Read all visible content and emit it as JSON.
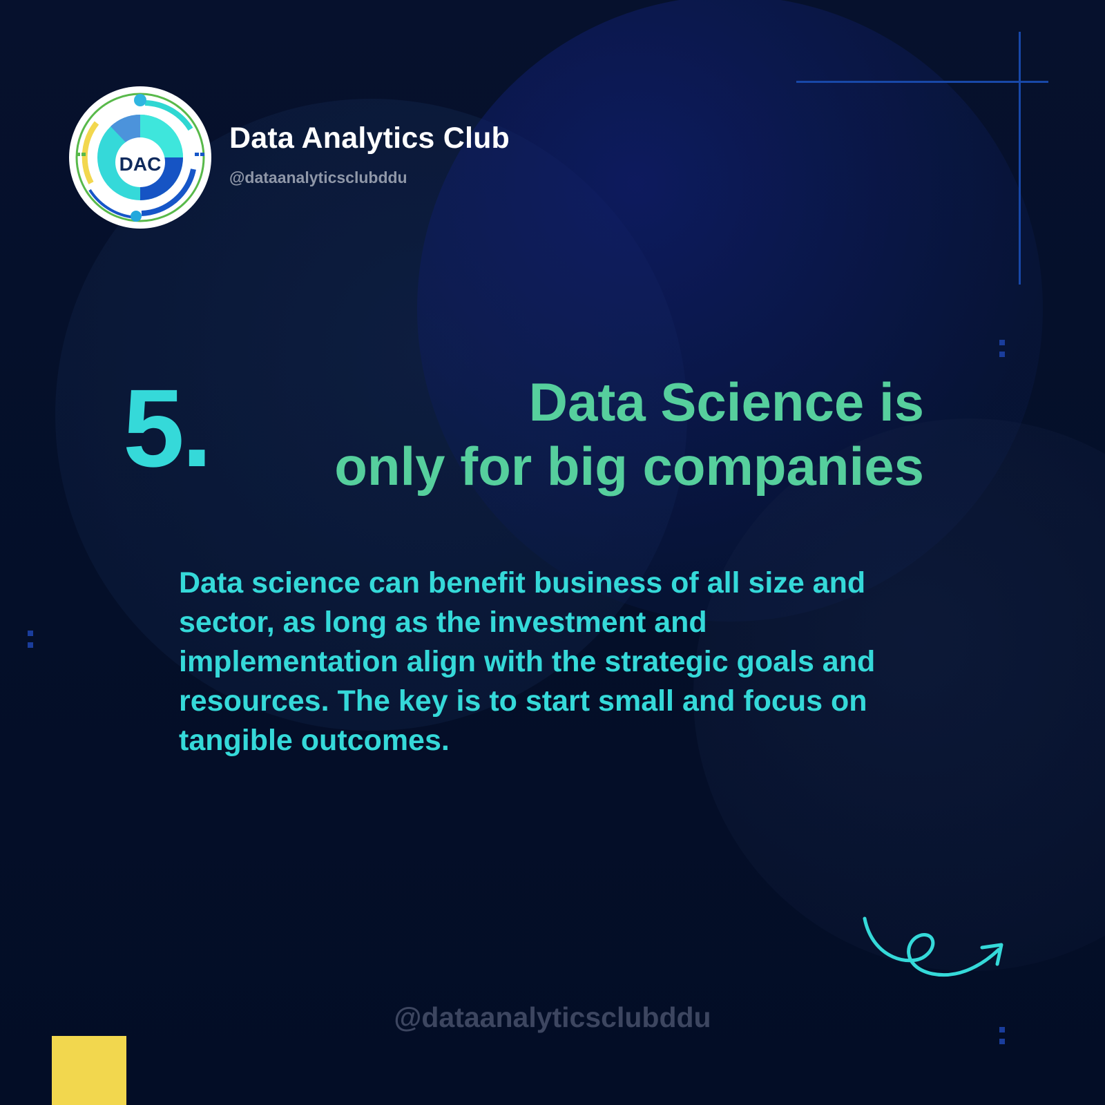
{
  "brand": {
    "title": "Data Analytics Club",
    "handle": "@dataanalyticsclubddu",
    "logo_text": "DAC"
  },
  "item": {
    "number": "5.",
    "headline_lines": [
      "Data Science is",
      "only for big companies"
    ],
    "body_lines": [
      "Data science can benefit business of all size and",
      "sector, as long as the investment and",
      "implementation align with the strategic goals and",
      "resources. The key is to start small and focus on",
      "tangible outcomes."
    ]
  },
  "footer": {
    "handle": "@dataanalyticsclubddu"
  },
  "colors": {
    "background": "#061030",
    "number": "#35d9d9",
    "headline": "#56cf9d",
    "body": "#35d9d9",
    "accent_line": "#1848a8",
    "yellow": "#f2d74e",
    "footer_text": "#3d4660"
  },
  "icons": {
    "logo": "dac-logo-icon",
    "arrow": "curly-arrow-icon"
  }
}
